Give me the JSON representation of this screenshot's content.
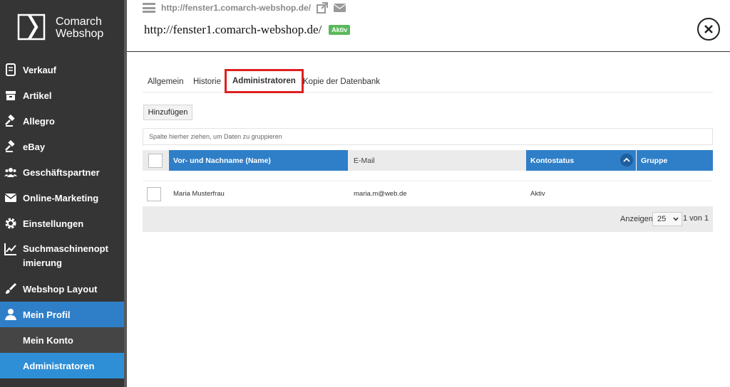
{
  "brand": {
    "line1": "Comarch",
    "line2": "Webshop"
  },
  "sidebar": {
    "items": [
      {
        "label": "Verkauf",
        "icon": "receipt-icon"
      },
      {
        "label": "Artikel",
        "icon": "box-icon"
      },
      {
        "label": "Allegro",
        "icon": "gavel-icon"
      },
      {
        "label": "eBay",
        "icon": "gavel-icon"
      },
      {
        "label": "Geschäftspartner",
        "icon": "users-icon"
      },
      {
        "label": "Online-Marketing",
        "icon": "envelope-icon"
      },
      {
        "label": "Einstellungen",
        "icon": "gear-icon"
      },
      {
        "label": "Suchmaschinenopt imierung",
        "icon": "chart-line-icon"
      },
      {
        "label": "Webshop Layout",
        "icon": "brush-icon"
      },
      {
        "label": "Mein Profil",
        "icon": "user-icon"
      }
    ],
    "sub_items": [
      {
        "label": "Mein Konto"
      },
      {
        "label": "Administratoren"
      }
    ]
  },
  "header": {
    "top_url": "http://fenster1.comarch-webshop.de/",
    "title": "http://fenster1.comarch-webshop.de/",
    "status": "Aktiv"
  },
  "tabs": [
    {
      "label": "Allgemein"
    },
    {
      "label": "Historie"
    },
    {
      "label": "Administratoren"
    },
    {
      "label": "Kopie der Datenbank"
    }
  ],
  "toolbar": {
    "add_label": "Hinzufügen",
    "group_hint": "Spalte hierher ziehen, um Daten zu gruppieren"
  },
  "grid": {
    "columns": [
      "Vor- und Nachname (Name)",
      "E-Mail",
      "Kontostatus",
      "Gruppe"
    ],
    "rows": [
      {
        "name": "Maria Musterfrau",
        "email": "maria.m@web.de",
        "status": "Aktiv",
        "group": ""
      }
    ]
  },
  "pager": {
    "label": "Anzeigen",
    "page_size": "25",
    "info": "1 von 1"
  },
  "colors": {
    "accent": "#2f7fc8",
    "sidebar": "#353535",
    "highlight": "#e02020",
    "badge": "#5cb85c"
  }
}
